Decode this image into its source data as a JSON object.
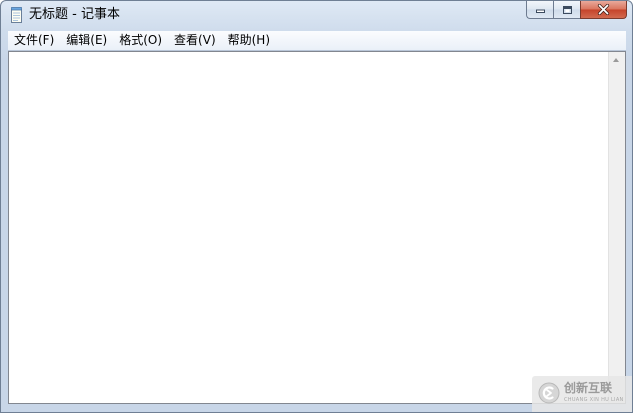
{
  "window": {
    "title": "无标题 - 记事本",
    "app_icon": "notepad-icon"
  },
  "caption_buttons": {
    "minimize_icon": "minimize-icon",
    "maximize_icon": "maximize-icon",
    "close_icon": "close-icon"
  },
  "menu": {
    "items": [
      {
        "label": "文件(F)"
      },
      {
        "label": "编辑(E)"
      },
      {
        "label": "格式(O)"
      },
      {
        "label": "查看(V)"
      },
      {
        "label": "帮助(H)"
      }
    ]
  },
  "editor": {
    "content": ""
  },
  "watermark": {
    "text": "创新互联",
    "subtext": "CHUANG XIN HU LIAN"
  },
  "colors": {
    "close_button": "#c5432a",
    "frame": "#c8d6e8"
  }
}
